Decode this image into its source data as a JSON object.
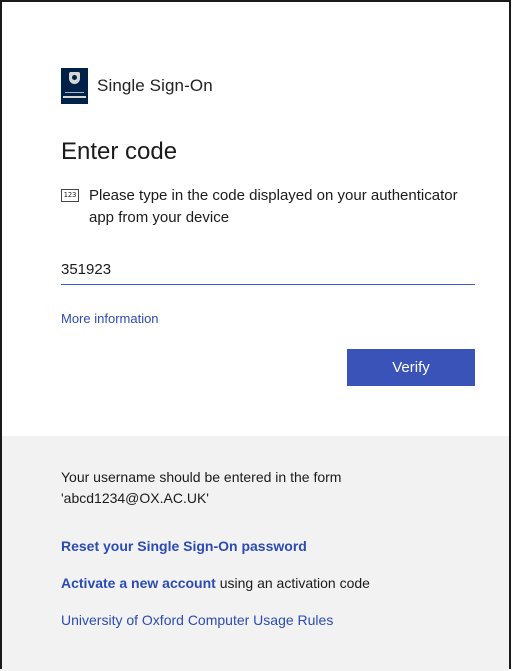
{
  "brand": {
    "title": "Single Sign-On",
    "logo_text": "UNIVERSITY OF OXFORD"
  },
  "form": {
    "heading": "Enter code",
    "instruction_icon_text": "123",
    "instruction": "Please type in the code displayed on your authenticator app from your device",
    "code_value": "351923",
    "more_info_label": "More information",
    "verify_label": "Verify"
  },
  "footer": {
    "hint_line1": "Your username should be entered in the form",
    "hint_line2": "'abcd1234@OX.AC.UK'",
    "reset_label": "Reset your Single Sign-On password",
    "activate_label": "Activate a new account",
    "activate_suffix": " using an activation code",
    "rules_label": "University of Oxford Computer Usage Rules"
  },
  "colors": {
    "accent": "#3953b8",
    "link": "#2c4bb5",
    "footer_bg": "#f2f2f2",
    "logo_bg": "#002147"
  }
}
